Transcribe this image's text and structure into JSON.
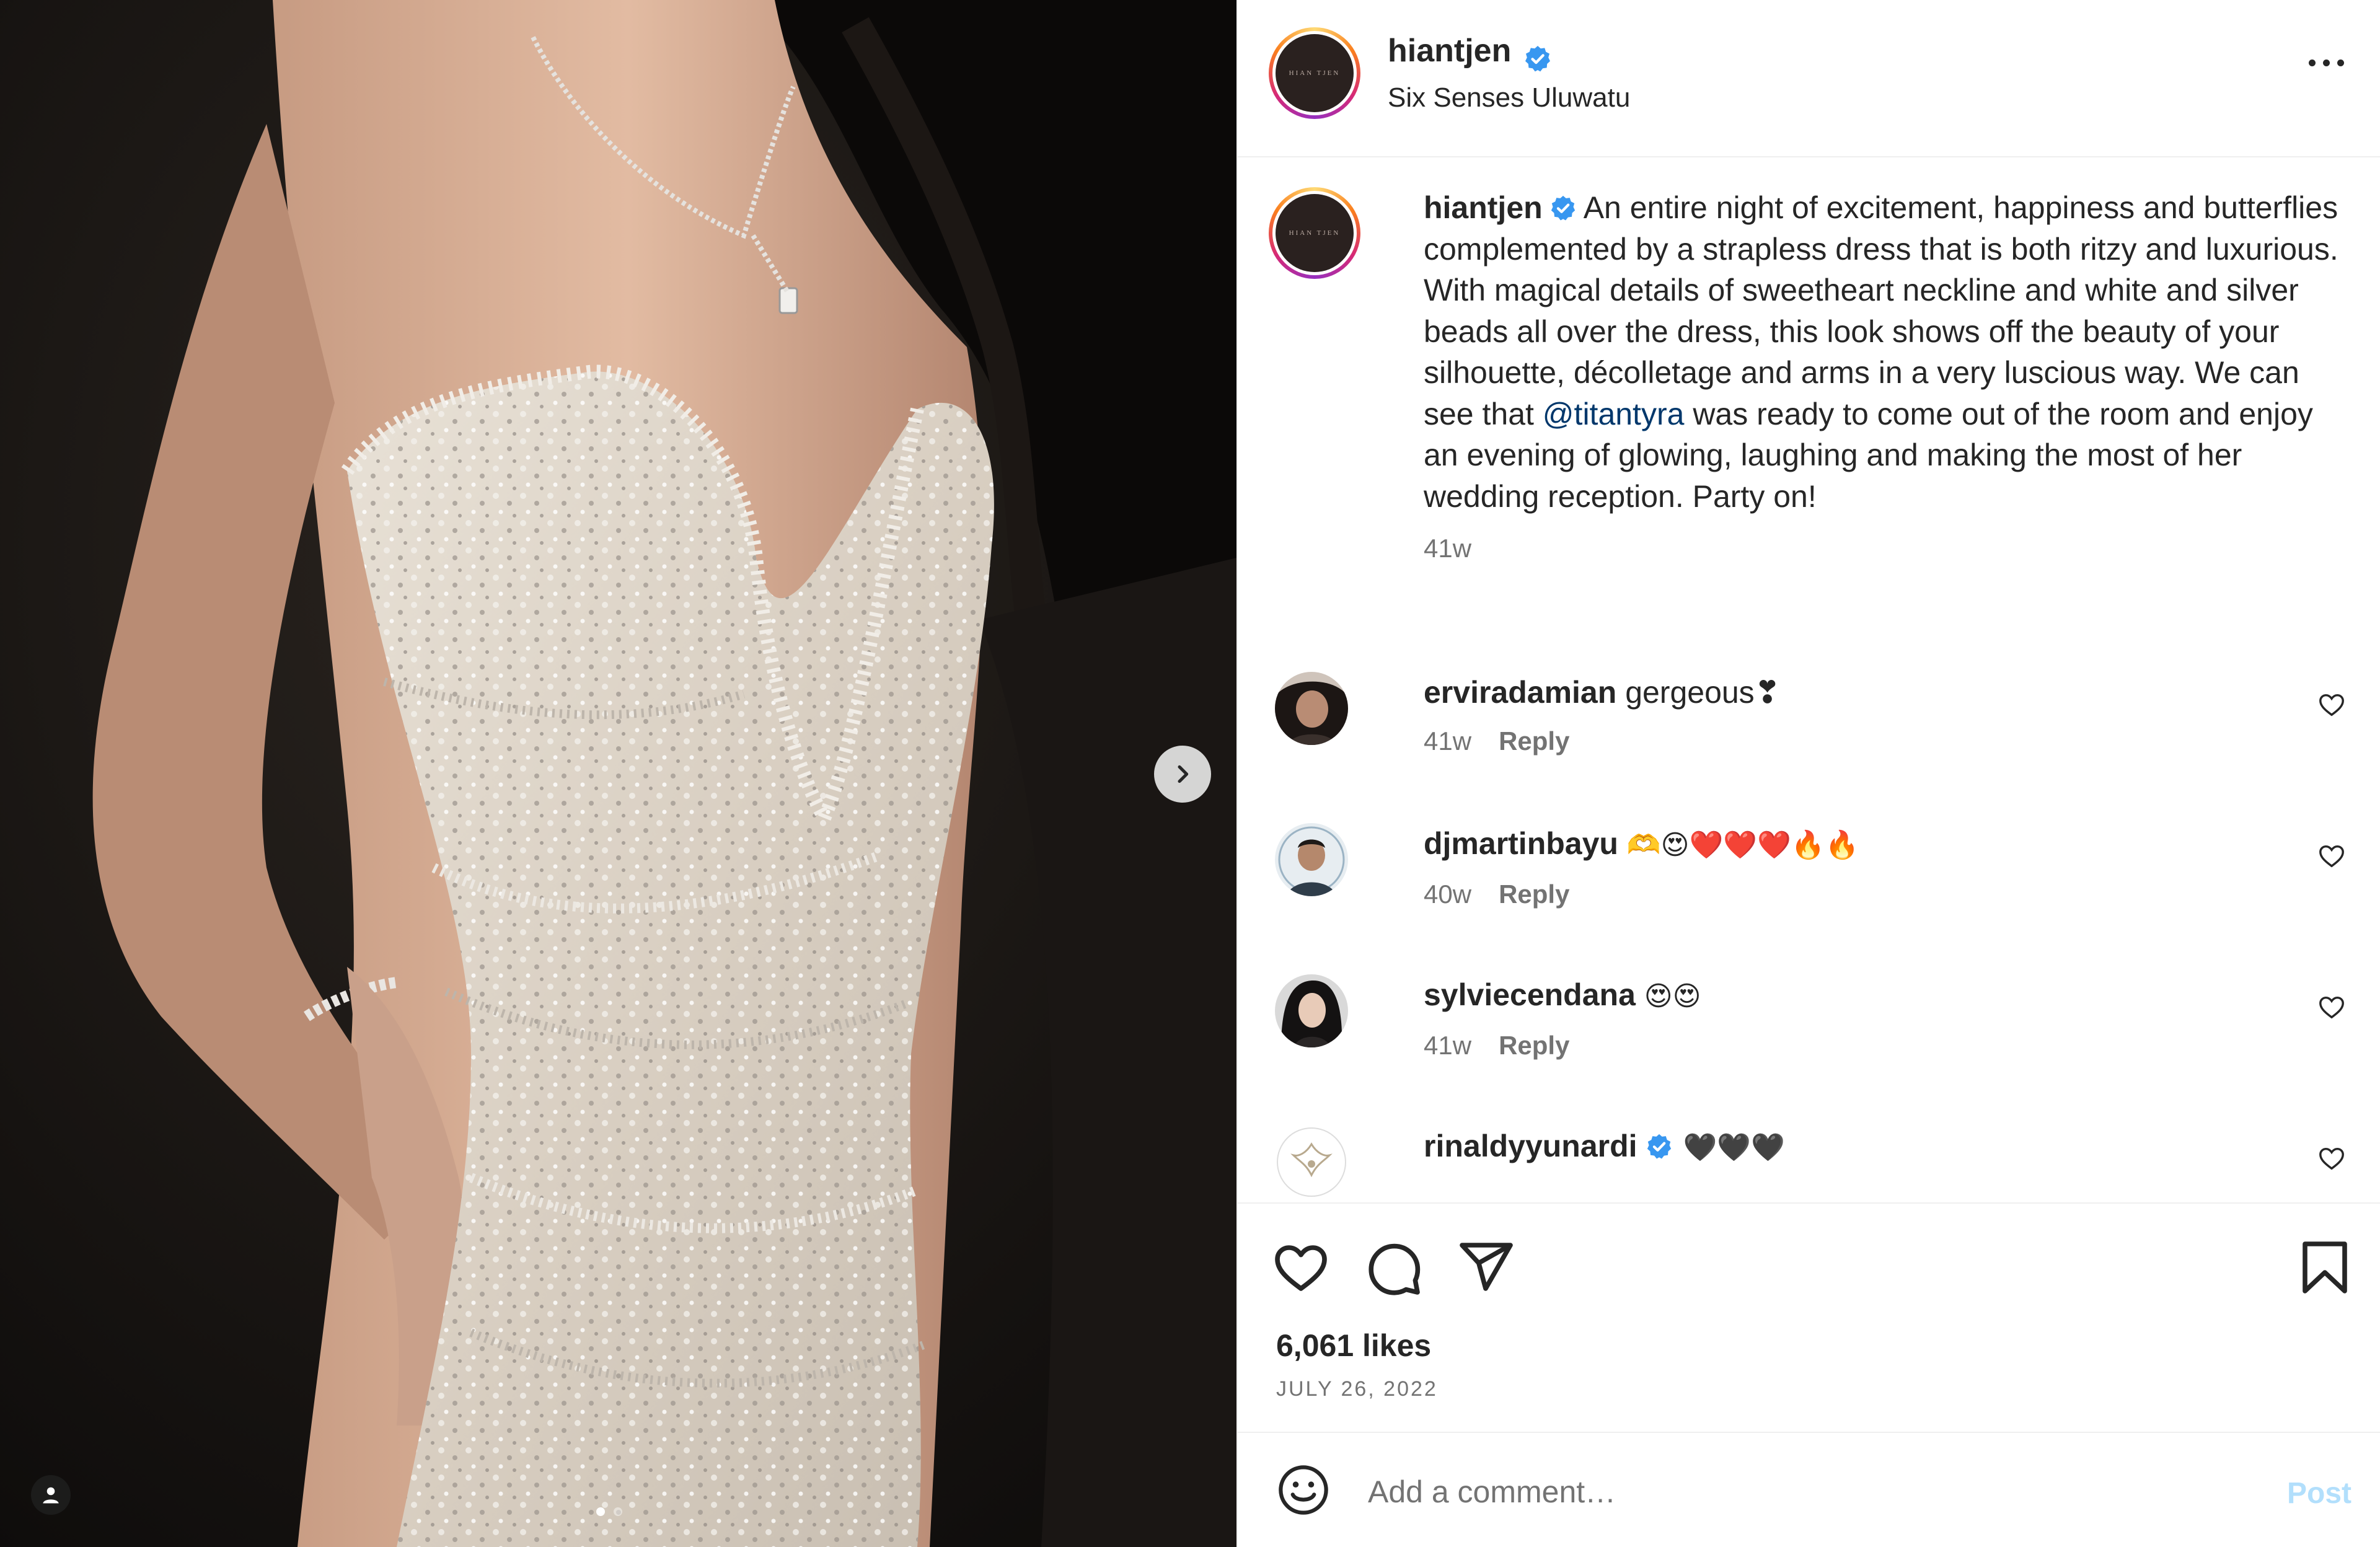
{
  "post": {
    "author": "hiantjen",
    "location": "Six Senses Uluwatu",
    "avatar_text": "HIAN TJEN"
  },
  "caption": {
    "username": "hiantjen",
    "text_before_mention": "An entire night of excitement, happiness and butterflies complemented by a strapless dress that is both ritzy and luxurious. With magical details of sweetheart neckline and white and silver beads all over the dress, this look shows off the beauty of your silhouette, décolletage and arms in a very luscious way. We can see that ",
    "mention": "@titantyra",
    "text_after_mention": " was ready to come out of the room and enjoy an evening of glowing, laughing and making the most of her wedding reception. Party on!",
    "time": "41w"
  },
  "comments": [
    {
      "username": "erviradamian",
      "text": "gergeous❣",
      "time": "41w",
      "reply_label": "Reply"
    },
    {
      "username": "djmartinbayu",
      "text": "🫶😍❤️❤️❤️🔥🔥",
      "time": "40w",
      "reply_label": "Reply"
    },
    {
      "username": "sylviecendana",
      "text": "😍😍",
      "time": "41w",
      "reply_label": "Reply"
    },
    {
      "username": "rinaldyyunardi",
      "text": "🖤🖤🖤",
      "time": "",
      "reply_label": ""
    }
  ],
  "stats": {
    "likes": "6,061 likes",
    "date": "JULY 26, 2022"
  },
  "composer": {
    "placeholder": "Add a comment…",
    "post_label": "Post"
  },
  "colors": {
    "verified": "#3897f0",
    "mention": "#00376b",
    "muted": "#737373",
    "post_disabled": "#b2dffc",
    "divider": "#efefef"
  }
}
